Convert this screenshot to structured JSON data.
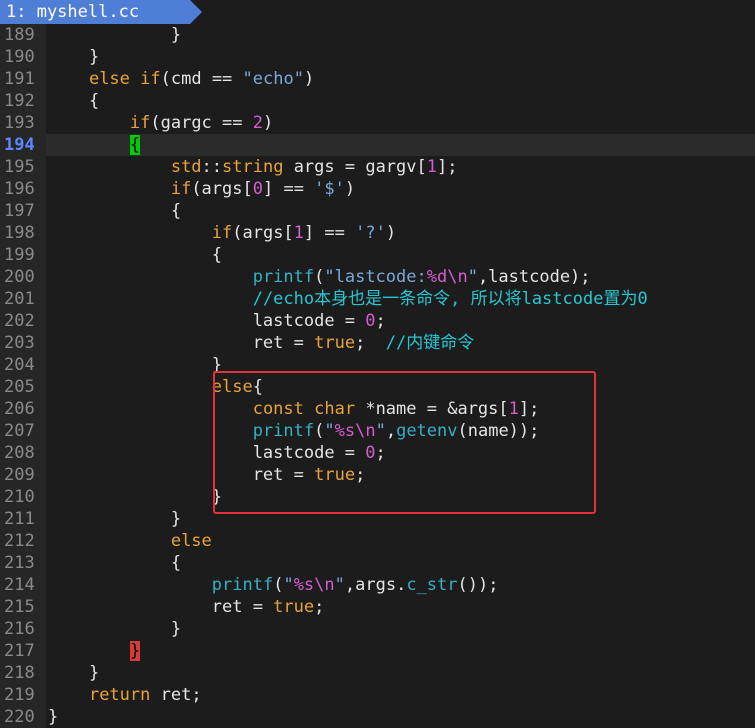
{
  "tab": {
    "label": "1: myshell.cc"
  },
  "colors": {
    "tab_bg": "#4f7ed7",
    "keyword": "#e8a33d",
    "number": "#d45dd1",
    "string": "#7aa8d8",
    "function": "#35b0c4",
    "comment": "#27c7d1",
    "cursor_bg": "#00cc00",
    "match_bg": "#d93a3a",
    "annotation_box": "#e5313b"
  },
  "current_line": "194",
  "lines": [
    {
      "num": "189",
      "tokens": [
        [
          "t",
          "            }"
        ]
      ]
    },
    {
      "num": "190",
      "tokens": [
        [
          "t",
          "    }"
        ]
      ]
    },
    {
      "num": "191",
      "tokens": [
        [
          "t",
          "    "
        ],
        [
          "kw",
          "else"
        ],
        [
          "t",
          " "
        ],
        [
          "kw",
          "if"
        ],
        [
          "t",
          "(cmd == "
        ],
        [
          "str",
          "\"echo\""
        ],
        [
          "t",
          ")"
        ]
      ]
    },
    {
      "num": "192",
      "tokens": [
        [
          "t",
          "    {"
        ]
      ]
    },
    {
      "num": "193",
      "tokens": [
        [
          "t",
          "        "
        ],
        [
          "kw",
          "if"
        ],
        [
          "t",
          "(gargc == "
        ],
        [
          "num",
          "2"
        ],
        [
          "t",
          ")"
        ]
      ]
    },
    {
      "num": "194",
      "tokens": [
        [
          "t",
          "        "
        ],
        [
          "cur",
          "{"
        ]
      ]
    },
    {
      "num": "195",
      "tokens": [
        [
          "t",
          "            "
        ],
        [
          "ty",
          "std"
        ],
        [
          "t",
          "::"
        ],
        [
          "ty",
          "string"
        ],
        [
          "t",
          " args = gargv["
        ],
        [
          "num",
          "1"
        ],
        [
          "t",
          "];"
        ]
      ]
    },
    {
      "num": "196",
      "tokens": [
        [
          "t",
          "            "
        ],
        [
          "kw",
          "if"
        ],
        [
          "t",
          "(args["
        ],
        [
          "num",
          "0"
        ],
        [
          "t",
          "] == "
        ],
        [
          "str",
          "'$'"
        ],
        [
          "t",
          ")"
        ]
      ]
    },
    {
      "num": "197",
      "tokens": [
        [
          "t",
          "            {"
        ]
      ]
    },
    {
      "num": "198",
      "tokens": [
        [
          "t",
          "                "
        ],
        [
          "kw",
          "if"
        ],
        [
          "t",
          "(args["
        ],
        [
          "num",
          "1"
        ],
        [
          "t",
          "] == "
        ],
        [
          "str",
          "'?'"
        ],
        [
          "t",
          ")"
        ]
      ]
    },
    {
      "num": "199",
      "tokens": [
        [
          "t",
          "                {"
        ]
      ]
    },
    {
      "num": "200",
      "tokens": [
        [
          "t",
          "                    "
        ],
        [
          "fn",
          "printf"
        ],
        [
          "t",
          "("
        ],
        [
          "str",
          "\"lastcode:"
        ],
        [
          "num",
          "%d\\n"
        ],
        [
          "str",
          "\""
        ],
        [
          "t",
          ",lastcode);"
        ]
      ]
    },
    {
      "num": "201",
      "tokens": [
        [
          "t",
          "                    "
        ],
        [
          "cm",
          "//echo本身也是一条命令, 所以将lastcode置为0"
        ]
      ]
    },
    {
      "num": "202",
      "tokens": [
        [
          "t",
          "                    lastcode = "
        ],
        [
          "num",
          "0"
        ],
        [
          "t",
          ";"
        ]
      ]
    },
    {
      "num": "203",
      "tokens": [
        [
          "t",
          "                    ret = "
        ],
        [
          "kw",
          "true"
        ],
        [
          "t",
          ";  "
        ],
        [
          "cm",
          "//内键命令"
        ]
      ]
    },
    {
      "num": "204",
      "tokens": [
        [
          "t",
          "                }"
        ]
      ]
    },
    {
      "num": "205",
      "tokens": [
        [
          "t",
          "                "
        ],
        [
          "kw",
          "else"
        ],
        [
          "t",
          "{"
        ]
      ]
    },
    {
      "num": "206",
      "tokens": [
        [
          "t",
          "                    "
        ],
        [
          "ty",
          "const"
        ],
        [
          "t",
          " "
        ],
        [
          "ty",
          "char"
        ],
        [
          "t",
          " *name = &args["
        ],
        [
          "num",
          "1"
        ],
        [
          "t",
          "];"
        ]
      ]
    },
    {
      "num": "207",
      "tokens": [
        [
          "t",
          "                    "
        ],
        [
          "fn",
          "printf"
        ],
        [
          "t",
          "("
        ],
        [
          "str",
          "\""
        ],
        [
          "num",
          "%s\\n"
        ],
        [
          "str",
          "\""
        ],
        [
          "t",
          ","
        ],
        [
          "fn",
          "getenv"
        ],
        [
          "t",
          "(name));"
        ]
      ]
    },
    {
      "num": "208",
      "tokens": [
        [
          "t",
          "                    lastcode = "
        ],
        [
          "num",
          "0"
        ],
        [
          "t",
          ";"
        ]
      ]
    },
    {
      "num": "209",
      "tokens": [
        [
          "t",
          "                    ret = "
        ],
        [
          "kw",
          "true"
        ],
        [
          "t",
          ";"
        ]
      ]
    },
    {
      "num": "210",
      "tokens": [
        [
          "t",
          "                }"
        ]
      ]
    },
    {
      "num": "211",
      "tokens": [
        [
          "t",
          "            }"
        ]
      ]
    },
    {
      "num": "212",
      "tokens": [
        [
          "t",
          "            "
        ],
        [
          "kw",
          "else"
        ]
      ]
    },
    {
      "num": "213",
      "tokens": [
        [
          "t",
          "            {"
        ]
      ]
    },
    {
      "num": "214",
      "tokens": [
        [
          "t",
          "                "
        ],
        [
          "fn",
          "printf"
        ],
        [
          "t",
          "("
        ],
        [
          "str",
          "\""
        ],
        [
          "num",
          "%s\\n"
        ],
        [
          "str",
          "\""
        ],
        [
          "t",
          ",args."
        ],
        [
          "fn",
          "c_str"
        ],
        [
          "t",
          "());"
        ]
      ]
    },
    {
      "num": "215",
      "tokens": [
        [
          "t",
          "                ret = "
        ],
        [
          "kw",
          "true"
        ],
        [
          "t",
          ";"
        ]
      ]
    },
    {
      "num": "216",
      "tokens": [
        [
          "t",
          "            }"
        ]
      ]
    },
    {
      "num": "217",
      "tokens": [
        [
          "t",
          "        "
        ],
        [
          "match",
          "}"
        ]
      ]
    },
    {
      "num": "218",
      "tokens": [
        [
          "t",
          "    }"
        ]
      ]
    },
    {
      "num": "219",
      "tokens": [
        [
          "t",
          "    "
        ],
        [
          "kw",
          "return"
        ],
        [
          "t",
          " ret;"
        ]
      ]
    },
    {
      "num": "220",
      "tokens": [
        [
          "t",
          "}"
        ]
      ]
    }
  ]
}
